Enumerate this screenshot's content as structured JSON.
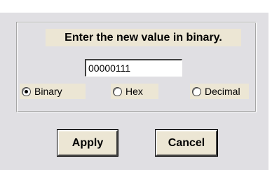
{
  "dialog": {
    "prompt": "Enter the new value in binary.",
    "input_value": "00000111",
    "radios": [
      {
        "label": "Binary",
        "selected": true
      },
      {
        "label": "Hex",
        "selected": false
      },
      {
        "label": "Decimal",
        "selected": false
      }
    ],
    "apply_label": "Apply",
    "cancel_label": "Cancel"
  },
  "colors": {
    "dialog_bg": "#e0dfe3",
    "label_bg": "#ece6d4"
  }
}
